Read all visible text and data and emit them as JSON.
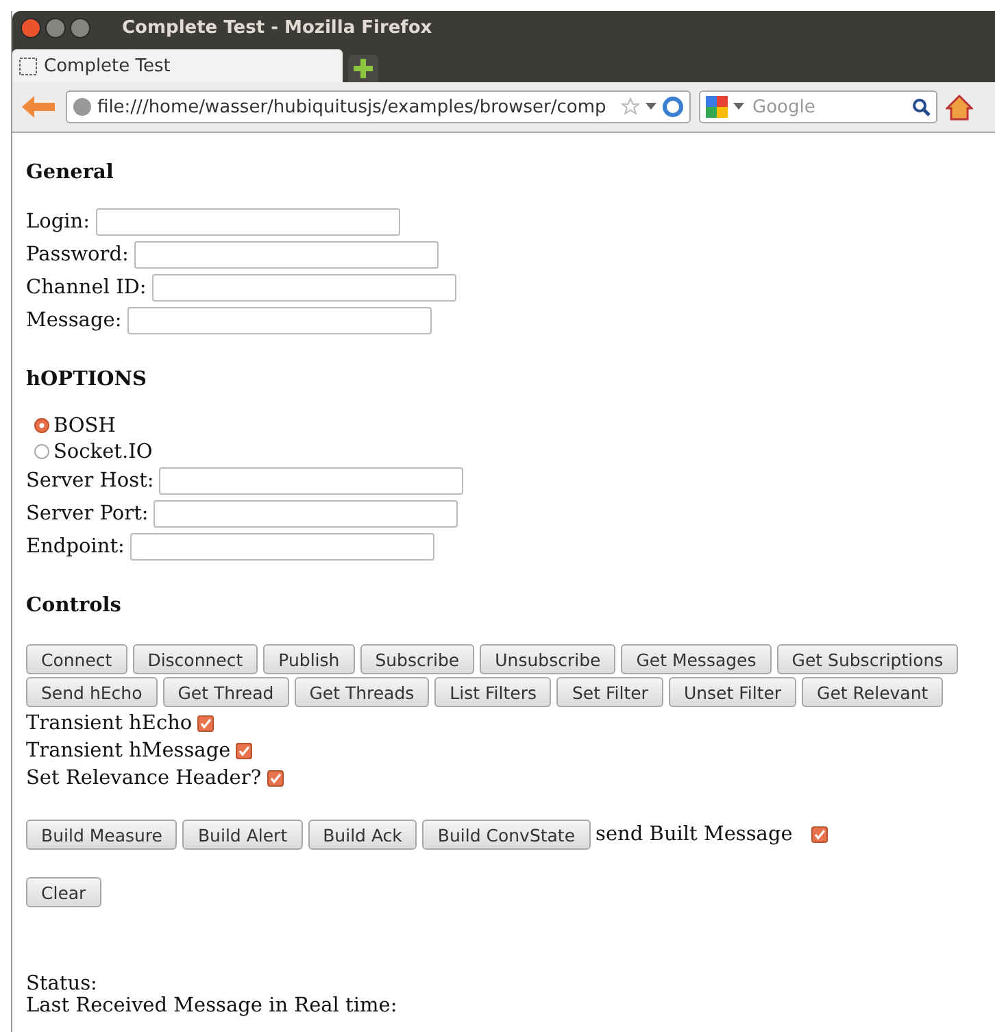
{
  "window": {
    "title": "Complete Test - Mozilla Firefox"
  },
  "tabs": [
    {
      "label": "Complete Test",
      "selected": true
    }
  ],
  "address_bar": {
    "value": "file:///home/wasser/hubiquitusjs/examples/browser/comp"
  },
  "search": {
    "placeholder": "Google"
  },
  "general": {
    "heading": "General",
    "fields": [
      {
        "label": "Login:"
      },
      {
        "label": "Password:"
      },
      {
        "label": "Channel ID:"
      },
      {
        "label": "Message:"
      }
    ]
  },
  "hoptions": {
    "heading": "hOPTIONS",
    "transports": [
      {
        "label": "BOSH",
        "selected": true
      },
      {
        "label": "Socket.IO",
        "selected": false
      }
    ],
    "fields": [
      {
        "label": "Server Host:"
      },
      {
        "label": "Server Port:"
      },
      {
        "label": "Endpoint:"
      }
    ]
  },
  "controls": {
    "heading": "Controls",
    "button_rows": [
      [
        "Connect",
        "Disconnect",
        "Publish",
        "Subscribe",
        "Unsubscribe",
        "Get Messages",
        "Get Subscriptions"
      ],
      [
        "Send hEcho",
        "Get Thread",
        "Get Threads",
        "List Filters",
        "Set Filter",
        "Unset Filter",
        "Get Relevant"
      ]
    ],
    "options": [
      {
        "label": "Transient hEcho",
        "checked": true
      },
      {
        "label": "Transient hMessage",
        "checked": true
      },
      {
        "label": "Set Relevance Header?",
        "checked": true
      }
    ],
    "build_buttons": [
      "Build Measure",
      "Build Alert",
      "Build Ack",
      "Build ConvState"
    ],
    "send_built": {
      "label": "send Built Message",
      "checked": true
    },
    "clear_button": "Clear"
  },
  "status": {
    "label": "Status:"
  },
  "last_received": {
    "label": "Last Received Message in Real time:"
  }
}
